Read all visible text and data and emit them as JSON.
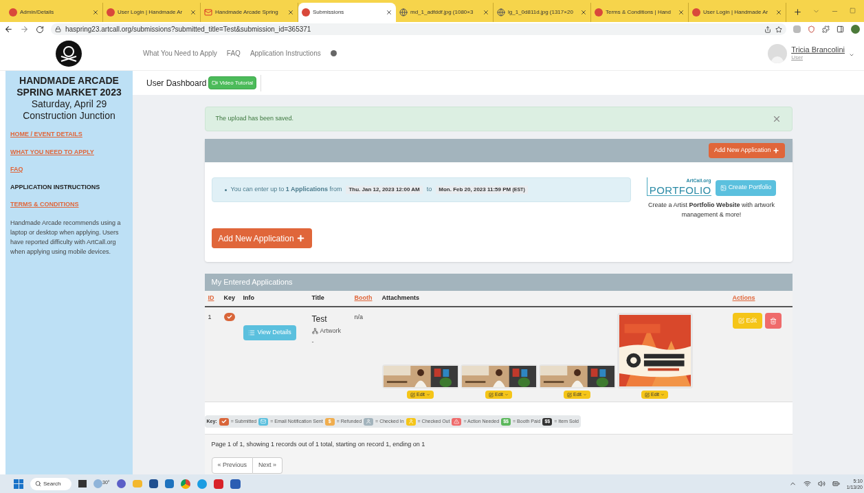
{
  "browser": {
    "tabs": [
      {
        "title": "Admin/Details",
        "selected": false,
        "kind": "site"
      },
      {
        "title": "User Login | Handmade Ar",
        "selected": false,
        "kind": "site"
      },
      {
        "title": "Handmade Arcade Spring",
        "selected": false,
        "kind": "mail"
      },
      {
        "title": "Submissions",
        "selected": true,
        "kind": "site"
      },
      {
        "title": "md_1_adfddf.jpg (1080×3",
        "selected": false,
        "kind": "globe"
      },
      {
        "title": "lg_1_0d811d.jpg (1317×20",
        "selected": false,
        "kind": "globe"
      },
      {
        "title": "Terms & Conditions | Hand",
        "selected": false,
        "kind": "site"
      },
      {
        "title": "User Login | Handmade Ar",
        "selected": false,
        "kind": "site"
      }
    ],
    "url": "haspring23.artcall.org/submissions?submitted_title=Test&submission_id=365371"
  },
  "header": {
    "nav": [
      "What You Need to Apply",
      "FAQ",
      "Application Instructions"
    ],
    "user": {
      "name": "Tricia Brancolini",
      "role": "User"
    }
  },
  "sidebar": {
    "title_lines": [
      "HANDMADE ARCADE",
      "SPRING MARKET 2023"
    ],
    "subtitle_lines": [
      "Saturday, April 29",
      "Construction Junction"
    ],
    "links": [
      {
        "label": "HOME / EVENT DETAILS",
        "kind": "link"
      },
      {
        "label": "WHAT YOU NEED TO APPLY",
        "kind": "link"
      },
      {
        "label": "FAQ",
        "kind": "link"
      },
      {
        "label": "APPLICATION INSTRUCTIONS",
        "kind": "plain"
      },
      {
        "label": "TERMS & CONDITIONS",
        "kind": "link"
      }
    ],
    "note": "Handmade Arcade recommends using a laptop or desktop when applying. Users have reported difficulty with ArtCall.org when applying using mobile devices."
  },
  "toolbar": {
    "title": "User Dashboard",
    "video_button": "Video Tutorial"
  },
  "alert": {
    "message": "The upload has been saved."
  },
  "applications_panel": {
    "header_button": "Add New Application",
    "info": "You can enter up to **1 Applications** from",
    "start": "Thu. Jan 12, 2023 12:00 AM",
    "connector": "to",
    "end": "Mon. Feb 20, 2023 11:59 PM",
    "timezone": "(EST)",
    "portfolio": {
      "brand": "ArtCall.org",
      "logo_word": "PORTFOLIO",
      "button": "Create Portfolio",
      "description": "Create a Artist **Portfolio Website** with artwork management & more!"
    },
    "main_button": "Add New Application"
  },
  "table": {
    "title": "My Entered Applications",
    "columns": [
      {
        "label": "ID",
        "sortable": true
      },
      {
        "label": "Key",
        "sortable": false
      },
      {
        "label": "Info",
        "sortable": false
      },
      {
        "label": "Title",
        "sortable": false
      },
      {
        "label": "Booth",
        "sortable": true
      },
      {
        "label": "Attachments",
        "sortable": false
      },
      {
        "label": "Actions",
        "sortable": true
      }
    ],
    "rows": [
      {
        "id": "1",
        "color": "#d9663a",
        "view_button": "View Details",
        "title": "Test",
        "category": "Artwork",
        "note": "-",
        "booth": "n/a",
        "attachments": [
          {
            "kind": "wide",
            "edit": "Edit"
          },
          {
            "kind": "wide",
            "edit": "Edit"
          },
          {
            "kind": "wide",
            "edit": "Edit"
          },
          {
            "kind": "poster",
            "edit": "Edit"
          }
        ],
        "edit_button": "Edit"
      }
    ]
  },
  "legend": {
    "label": "Key:",
    "items": [
      {
        "kind": "check",
        "color": "#d9663a",
        "label": "= Submitted"
      },
      {
        "kind": "mail",
        "color": "#5bc0de",
        "label": "= Email Notification Sent"
      },
      {
        "kind": "text",
        "badge": "$",
        "color": "#f0ad4e",
        "label": "= Refunded"
      },
      {
        "kind": "user",
        "color": "#a3b4bd",
        "label": "= Checked In"
      },
      {
        "kind": "user",
        "color": "#f5c518",
        "label": "= Checked Out"
      },
      {
        "kind": "warning",
        "color": "#ef6b6b",
        "label": "= Action Needed"
      },
      {
        "kind": "text",
        "badge": "$$",
        "color": "#5cb85c",
        "label": "= Booth Paid"
      },
      {
        "kind": "text",
        "badge": "$$",
        "color": "#333333",
        "label": "= Item Sold"
      }
    ]
  },
  "pagination": {
    "summary": "Page 1 of 1, showing 1 records out of 1 total, starting on record 1, ending on 1",
    "buttons": [
      "« Previous",
      "Next »"
    ]
  },
  "taskbar": {
    "search": "Search",
    "weather": "30°",
    "time": "5:10",
    "date": "1/13/20"
  }
}
